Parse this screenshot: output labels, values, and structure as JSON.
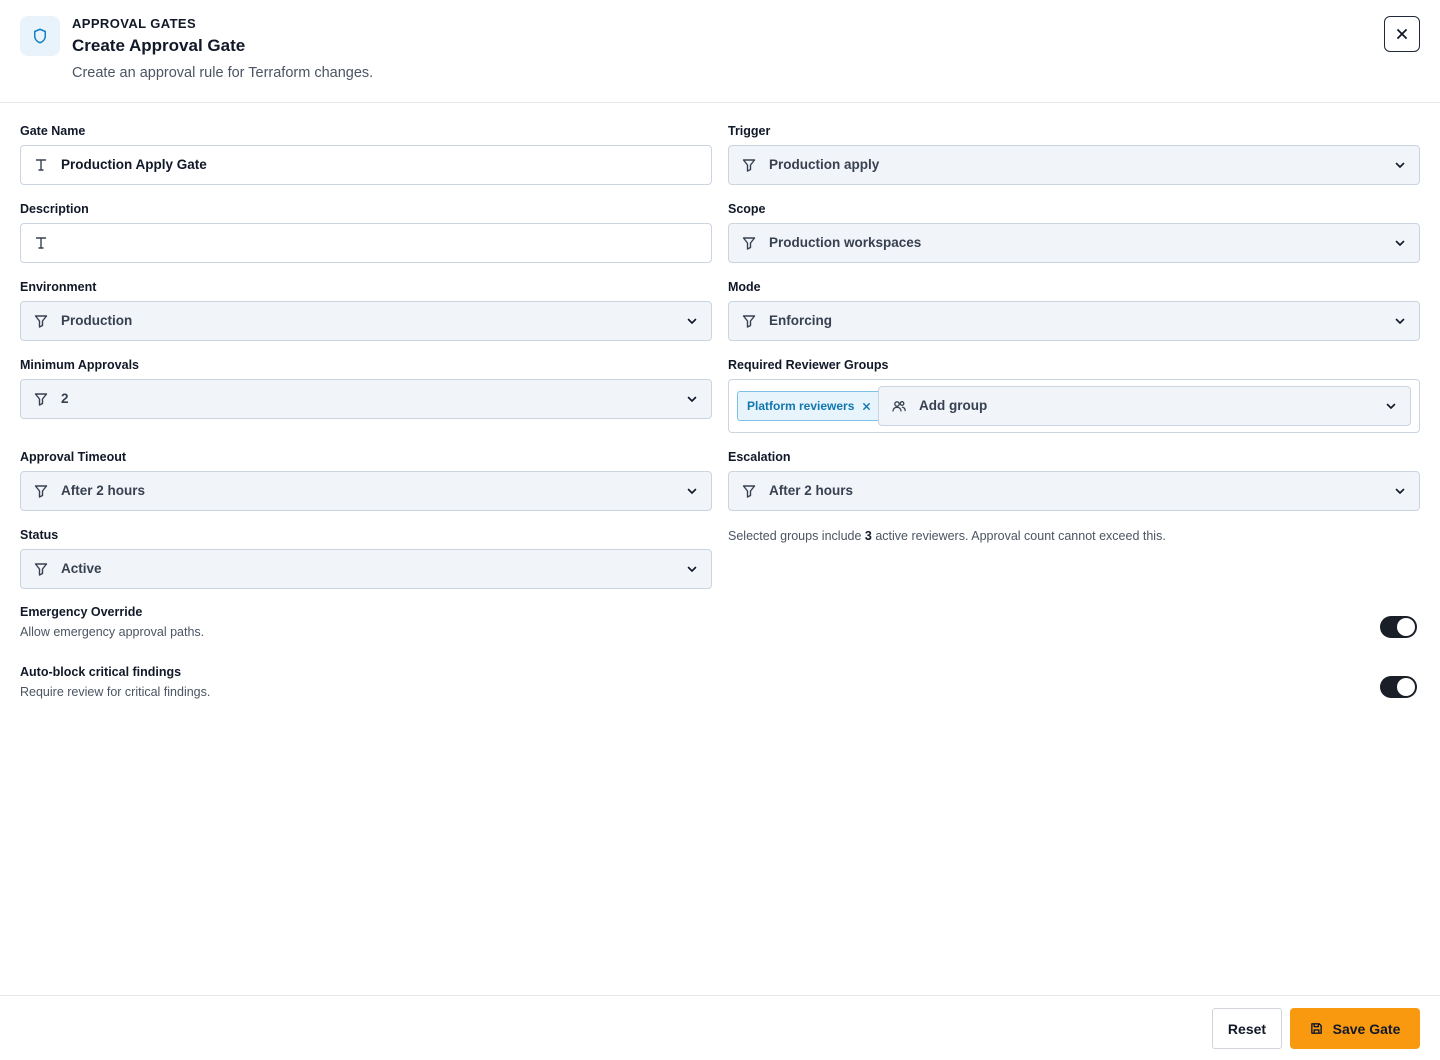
{
  "header": {
    "eyebrow": "APPROVAL GATES",
    "title": "Create Approval Gate",
    "subtitle": "Create an approval rule for Terraform changes.",
    "icon": "shield-icon",
    "close_icon": "close-icon"
  },
  "form": {
    "gate_name": {
      "label": "Gate Name",
      "value": "Production Apply Gate"
    },
    "description": {
      "label": "Description",
      "value": ""
    },
    "environment": {
      "label": "Environment",
      "value": "Production"
    },
    "minimum_approvals": {
      "label": "Minimum Approvals",
      "value": "2"
    },
    "approval_timeout": {
      "label": "Approval Timeout",
      "value": "After 2 hours"
    },
    "status": {
      "label": "Status",
      "value": "Active"
    },
    "trigger": {
      "label": "Trigger",
      "value": "Production apply"
    },
    "scope": {
      "label": "Scope",
      "value": "Production workspaces"
    },
    "mode": {
      "label": "Mode",
      "value": "Enforcing"
    },
    "reviewer_groups": {
      "label": "Required Reviewer Groups",
      "chips": [
        "Platform reviewers"
      ],
      "add_label": "Add group"
    },
    "escalation": {
      "label": "Escalation",
      "value": "After 2 hours"
    },
    "helper": {
      "prefix": "Selected groups include",
      "count": "3",
      "suffix": "active reviewers. Approval count cannot exceed this."
    }
  },
  "toggles": [
    {
      "title": "Emergency Override",
      "description": "Allow emergency approval paths.",
      "on": true
    },
    {
      "title": "Auto-block critical findings",
      "description": "Require review for critical findings.",
      "on": true
    }
  ],
  "footer": {
    "reset_label": "Reset",
    "save_label": "Save Gate"
  },
  "colors": {
    "accent": "#f8990f",
    "chip_text": "#1177b0",
    "chip_bg": "#e8f4fb",
    "toggle_on": "#1a1f27",
    "select_bg": "#f1f4f8"
  }
}
